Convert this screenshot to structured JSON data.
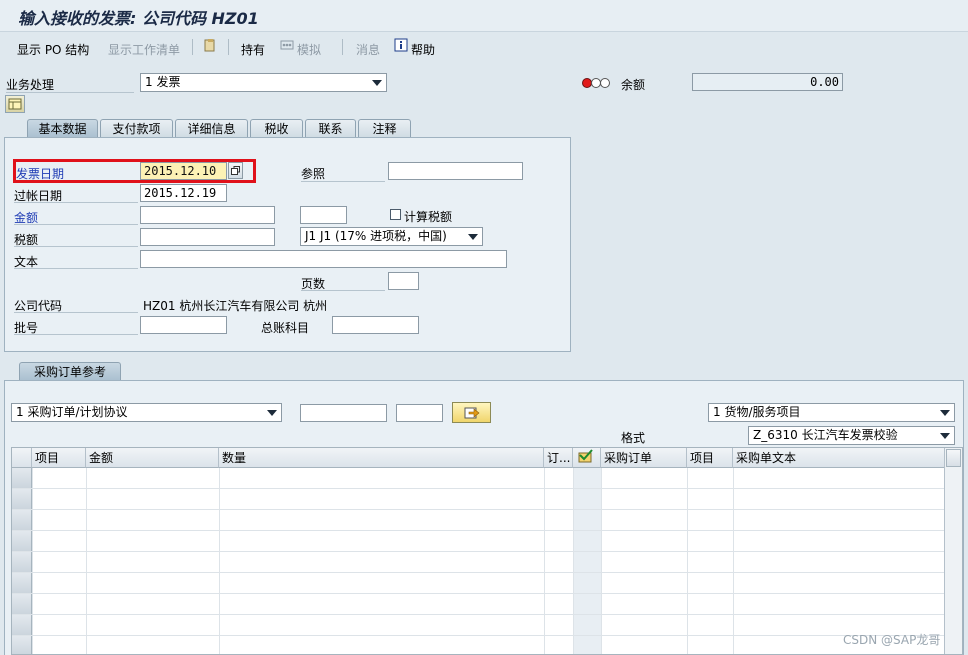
{
  "window": {
    "title": "输入接收的发票: 公司代码 HZ01"
  },
  "toolbar": {
    "show_po_structure": "显示 PO 结构",
    "show_worklist": "显示工作清单",
    "hold": "持有",
    "simulate": "模拟",
    "messages": "消息",
    "help": "帮助"
  },
  "header": {
    "transaction_label": "业务处理",
    "transaction_value": "1 发票",
    "balance_label": "余额",
    "balance_value": "0.00"
  },
  "tabs": [
    "基本数据",
    "支付款项",
    "详细信息",
    "税收",
    "联系",
    "注释"
  ],
  "basic_data": {
    "invoice_date_label": "发票日期",
    "invoice_date_value": "2015.12.10",
    "posting_date_label": "过帐日期",
    "posting_date_value": "2015.12.19",
    "amount_label": "金额",
    "amount_value": "",
    "currency_value": "",
    "tax_amount_label": "税额",
    "tax_amount_value": "",
    "calc_tax_label": "计算税额",
    "tax_code_value": "J1 J1 (17% 进项税，中国)",
    "text_label": "文本",
    "text_value": "",
    "reference_label": "参照",
    "reference_value": "",
    "pages_label": "页数",
    "pages_value": "",
    "company_code_label": "公司代码",
    "company_code_value": "HZ01 杭州长江汽车有限公司 杭州",
    "batch_label": "批号",
    "batch_value": "",
    "gl_account_label": "总账科目",
    "gl_account_value": ""
  },
  "po_reference": {
    "tab_label": "采购订单参考",
    "ref_type_value": "1 采购订单/计划协议",
    "po_number_value": "",
    "po_item_value": "",
    "item_type_value": "1 货物/服务项目",
    "layout_label": "格式",
    "layout_value": "Z_6310 长江汽车发票校验"
  },
  "grid": {
    "columns": [
      "项目",
      "金额",
      "数量",
      "订...",
      "",
      "采购订单",
      "项目",
      "采购单文本"
    ]
  },
  "watermark": "CSDN @SAP龙哥",
  "colors": {
    "highlight_border": "#e0111a",
    "field_highlight": "#fdf2b5",
    "link_blue": "#1f3cb5"
  }
}
